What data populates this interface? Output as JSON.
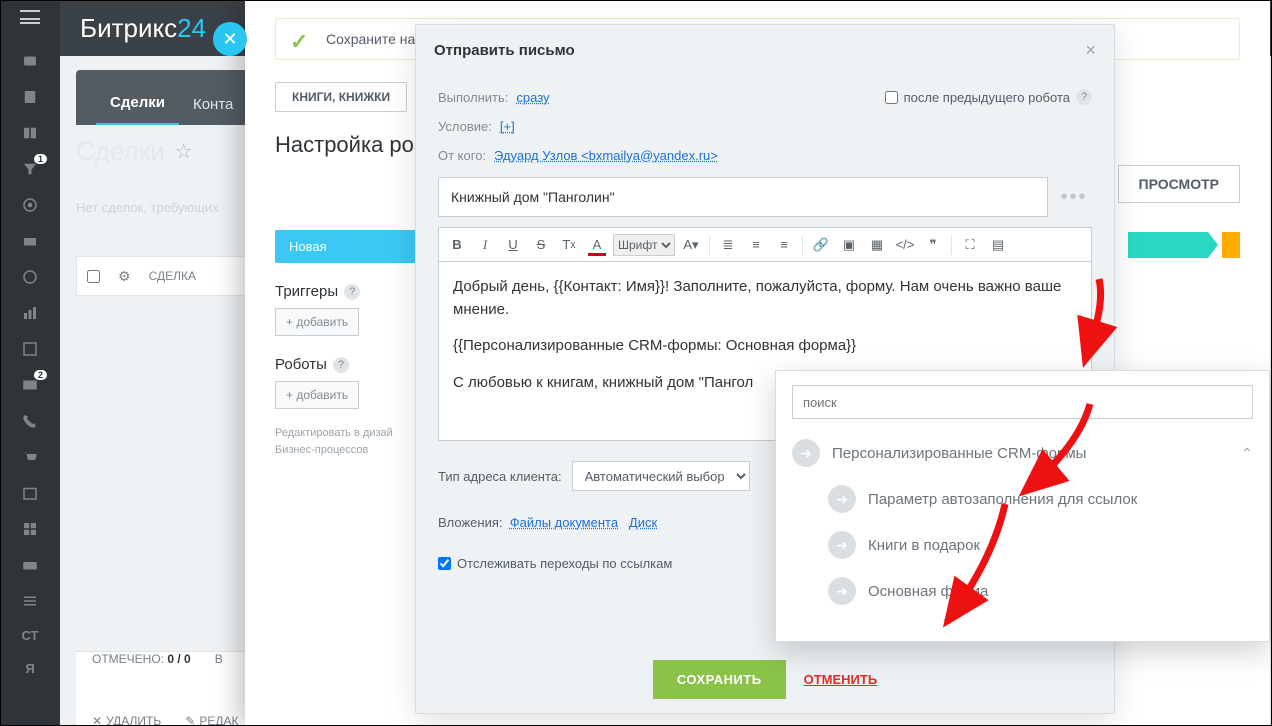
{
  "brand": {
    "name": "Битрикс",
    "suffix": "24"
  },
  "tabs": {
    "deals": "Сделки",
    "contacts": "Конта"
  },
  "page": {
    "title": "Сделки",
    "subtext": "Нет сделок, требующих"
  },
  "grid": {
    "col_deal": "СДЕЛКА"
  },
  "footer_strip": {
    "selected_label": "ОТМЕЧЕНО:",
    "selected_value": "0 / 0",
    "all_label": "В",
    "delete": "УДАЛИТЬ",
    "edit": "РЕДАК"
  },
  "panel": {
    "step_text": "Сохраните настройки и сразу же посмотрите как работает заданный вами сценарий",
    "books_btn": "КНИГИ, КНИЖКИ",
    "setup_title": "Настройка робо",
    "preview_btn": "ПРОСМОТР",
    "stage_pill": "Новая",
    "triggers_title": "Триггеры",
    "robots_title": "Роботы",
    "add_btn": "+ добавить",
    "edit_line1": "Редактировать в дизай",
    "edit_line2": "Бизнес-процессов"
  },
  "modal": {
    "title": "Отправить письмо",
    "execute_label": "Выполнить:",
    "execute_value": "сразу",
    "after_prev": "после предыдущего робота",
    "condition_label": "Условие:",
    "condition_value": "[+]",
    "from_label": "От кого:",
    "from_value": "Эдуард Узлов <bxmailya@yandex.ru>",
    "subject_value": "Книжный дом \"Панголин\"",
    "font_select": "Шрифт",
    "body_p1": "Добрый день, {{Контакт: Имя}}! Заполните, пожалуйста, форму. Нам очень важно ваше мнение.",
    "body_p2": "{{Персонализированные CRM-формы: Основная форма}}",
    "body_p3": "С любовью к книгам, книжный дом \"Пангол",
    "addr_label": "Тип адреса клиента:",
    "addr_value": "Автоматический выбор",
    "attach_label": "Вложения:",
    "attach_doc": "Файлы документа",
    "attach_disk": "Диск",
    "track_label": "Отслеживать переходы по ссылкам",
    "save": "СОХРАНИТЬ",
    "cancel": "ОТМЕНИТЬ"
  },
  "picker": {
    "search_placeholder": "поиск",
    "group": "Персонализированные CRM-формы",
    "item1": "Параметр автозаполнения для ссылок",
    "item2": "Книги в подарок",
    "item3": "Основная форма"
  },
  "rail": {
    "badge1": "1",
    "badge2": "2",
    "ct": "СТ",
    "ya": "Я"
  }
}
